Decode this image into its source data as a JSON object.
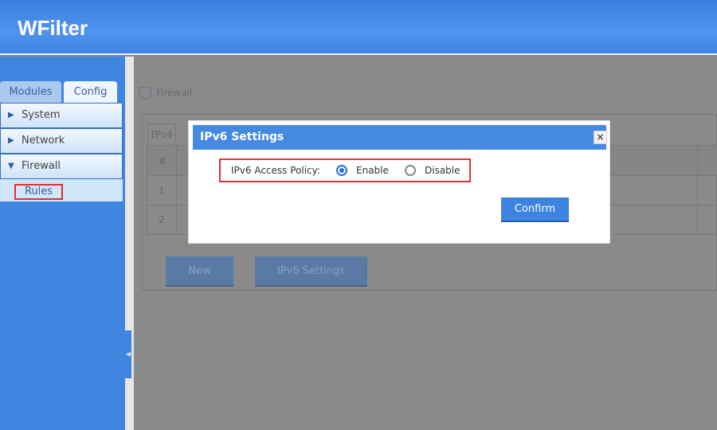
{
  "header": {
    "title": "WFilter"
  },
  "sidebar": {
    "tabs": [
      {
        "label": "Modules"
      },
      {
        "label": "Config"
      }
    ],
    "menu": [
      {
        "label": "System",
        "expanded": false
      },
      {
        "label": "Network",
        "expanded": false
      },
      {
        "label": "Firewall",
        "expanded": true
      }
    ],
    "submenu": [
      {
        "label": "Rules",
        "highlighted": true
      }
    ]
  },
  "main": {
    "section": "Firewall",
    "tab": "IPv4",
    "table": {
      "header": [
        "#"
      ],
      "rows": [
        [
          "1"
        ],
        [
          "2"
        ]
      ]
    },
    "buttons": {
      "new": "New",
      "ipv6": "IPv6  Settings"
    }
  },
  "dialog": {
    "title": "IPv6  Settings",
    "close": "×",
    "policy_label": "IPv6  Access  Policy:",
    "options": [
      {
        "label": "Enable",
        "selected": true
      },
      {
        "label": "Disable",
        "selected": false
      }
    ],
    "confirm": "Confirm"
  },
  "colors": {
    "accent": "#3d83e0",
    "highlight": "#e03535"
  }
}
